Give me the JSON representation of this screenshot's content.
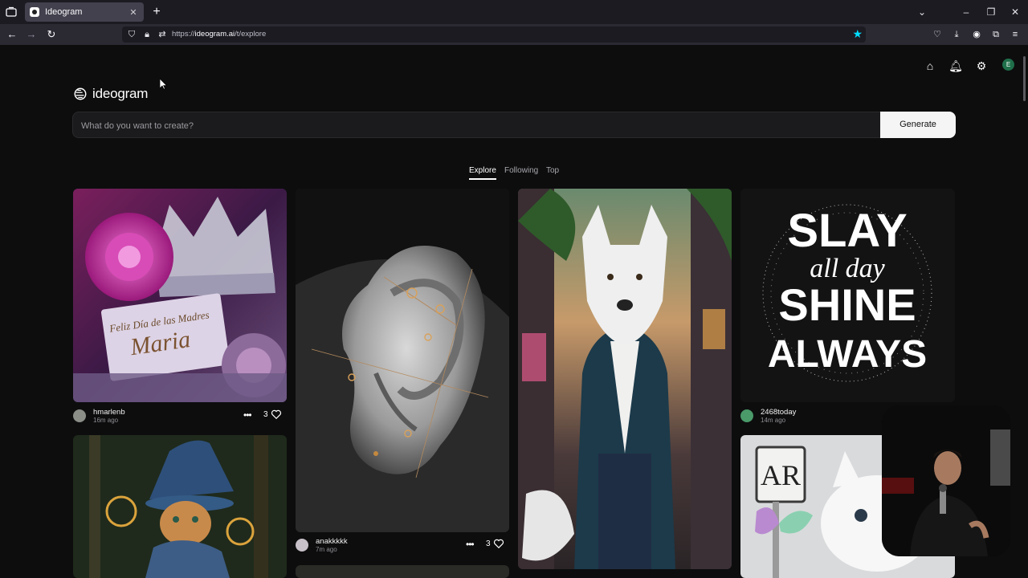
{
  "browser": {
    "tab_title": "Ideogram",
    "url_prefix": "https://",
    "url_domain": "ideogram.ai",
    "url_path": "/t/explore"
  },
  "brand": {
    "name": "ideogram"
  },
  "prompt": {
    "placeholder": "What do you want to create?",
    "generate_label": "Generate"
  },
  "nav_icons": [
    "home-icon",
    "bell-icon",
    "gear-icon"
  ],
  "account": {
    "initial": "E"
  },
  "feed_tabs": [
    {
      "label": "Explore",
      "active": true
    },
    {
      "label": "Following",
      "active": false
    },
    {
      "label": "Top",
      "active": false
    }
  ],
  "posts": [
    {
      "user": "hmarlenb",
      "time": "16m ago",
      "likes": "3",
      "image_text_1": "Feliz Día de las Madres",
      "image_text_2": "Maria"
    },
    {
      "user": "anakkkkk",
      "time": "7m ago",
      "likes": "3"
    },
    {
      "user": "2468today",
      "time": "14m ago",
      "image_text": [
        "SLAY",
        "all day",
        "SHINE",
        "ALWAYS"
      ]
    },
    {
      "image_text": "AR"
    }
  ],
  "colors": {
    "background": "#0d0d0e",
    "accent_star": "#00ddff",
    "avatar_bg": "#1f6f4a"
  }
}
